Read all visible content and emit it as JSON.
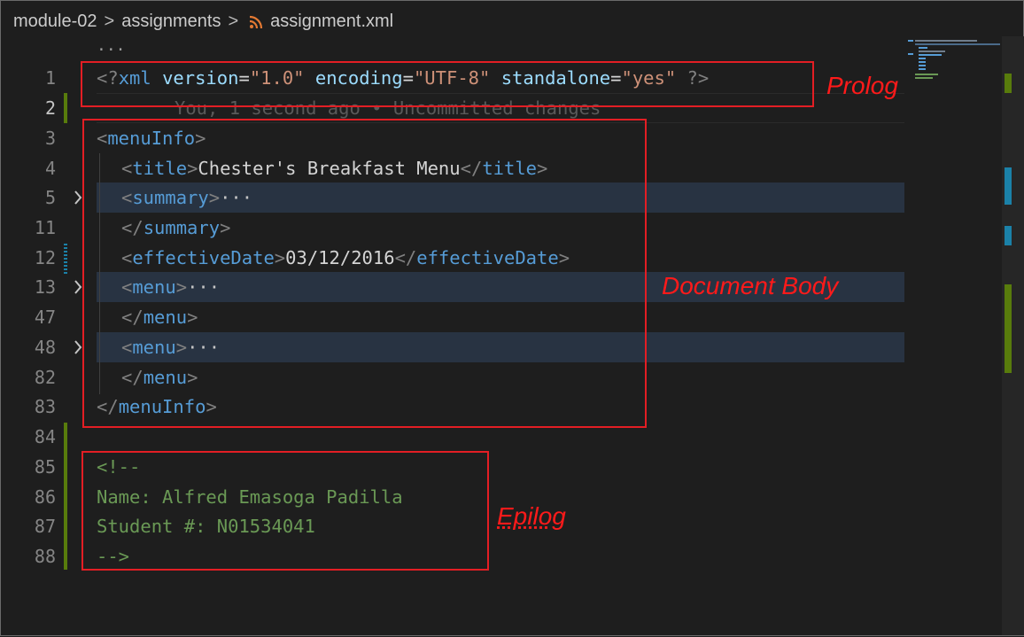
{
  "breadcrumb": {
    "folder": "module-02",
    "subfolder": "assignments",
    "file": "assignment.xml",
    "separator": ">"
  },
  "editor": {
    "top_ellipsis": "...",
    "lines": {
      "l1": {
        "num": "1",
        "open": "<?",
        "name": "xml",
        "attr1": "version",
        "eq": "=",
        "val1": "\"1.0\"",
        "attr2": "encoding",
        "val2": "\"UTF-8\"",
        "attr3": "standalone",
        "val3": "\"yes\"",
        "close": "?>"
      },
      "l2": {
        "num": "2",
        "blame": "You, 1 second ago • Uncommitted changes"
      },
      "l3": {
        "num": "3",
        "lt": "<",
        "tag": "menuInfo",
        "gt": ">"
      },
      "l4": {
        "num": "4",
        "lt": "<",
        "tag": "title",
        "gt": ">",
        "text": "Chester's Breakfast Menu",
        "clt": "</",
        "ctag": "title",
        "cgt": ">"
      },
      "l5": {
        "num": "5",
        "lt": "<",
        "tag": "summary",
        "gt": ">",
        "fold": "···"
      },
      "l11": {
        "num": "11",
        "lt": "</",
        "tag": "summary",
        "gt": ">"
      },
      "l12": {
        "num": "12",
        "lt": "<",
        "tag": "effectiveDate",
        "gt": ">",
        "text": "03/12/2016",
        "clt": "</",
        "ctag": "effectiveDate",
        "cgt": ">"
      },
      "l13": {
        "num": "13",
        "lt": "<",
        "tag": "menu",
        "gt": ">",
        "fold": "···"
      },
      "l47": {
        "num": "47",
        "lt": "</",
        "tag": "menu",
        "gt": ">"
      },
      "l48": {
        "num": "48",
        "lt": "<",
        "tag": "menu",
        "gt": ">",
        "fold": "···"
      },
      "l82": {
        "num": "82",
        "lt": "</",
        "tag": "menu",
        "gt": ">"
      },
      "l83": {
        "num": "83",
        "lt": "</",
        "tag": "menuInfo",
        "gt": ">"
      },
      "l84": {
        "num": "84"
      },
      "l85": {
        "num": "85",
        "text": "<!--"
      },
      "l86": {
        "num": "86",
        "text": "Name: Alfred Emasoga Padilla"
      },
      "l87": {
        "num": "87",
        "text": "Student #: N01534041"
      },
      "l88": {
        "num": "88",
        "text": "-->"
      }
    }
  },
  "annotations": {
    "prolog": "Prolog",
    "body": "Document Body",
    "epilog": "Epilog"
  },
  "colors": {
    "background": "#1e1e1e",
    "tag": "#569cd6",
    "attribute": "#9cdcfe",
    "string": "#ce9178",
    "comment": "#6a9955",
    "annotation": "#e31e24",
    "git_added": "#587c0c",
    "git_modified": "#1b81a8"
  },
  "icons": {
    "file_type": "rss-icon",
    "fold": "chevron-right-icon"
  }
}
